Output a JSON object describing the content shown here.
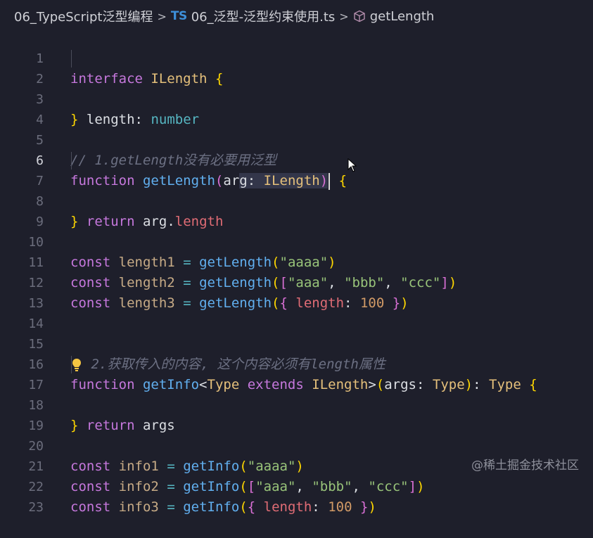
{
  "breadcrumb": {
    "folder": "06_TypeScript泛型编程",
    "ts_badge": "TS",
    "file": "06_泛型-泛型约束使用.ts",
    "symbol": "getLength",
    "icons": {
      "chevron": "chevron-right-icon",
      "symbol": "cube-icon"
    }
  },
  "lines": {
    "l1": "1",
    "l2": "2",
    "l3": "3",
    "l4": "4",
    "l5": "5",
    "l6": "6",
    "l7": "7",
    "l8": "8",
    "l9": "9",
    "l10": "10",
    "l11": "11",
    "l12": "12",
    "l13": "13",
    "l14": "14",
    "l15": "15",
    "l16": "16",
    "l17": "17",
    "l18": "18",
    "l19": "19",
    "l20": "20",
    "l21": "21",
    "l22": "22",
    "l23": "23"
  },
  "code": {
    "interface": "interface",
    "ILength": "ILength",
    "length": "length",
    "number": "number",
    "comment1": "// 1.getLength没有必要用泛型",
    "function": "function",
    "getLength": "getLength",
    "arg": "arg",
    "return": "return",
    "const": "const",
    "length1": "length1",
    "length2": "length2",
    "length3": "length3",
    "s_aaaa": "\"aaaa\"",
    "s_aaa": "\"aaa\"",
    "s_bbb": "\"bbb\"",
    "s_ccc": "\"ccc\"",
    "n100": "100",
    "comment2": "2.获取传入的内容, 这个内容必须有length属性",
    "getInfo": "getInfo",
    "Type": "Type",
    "extends": "extends",
    "args": "args",
    "info1": "info1",
    "info2": "info2",
    "info3": "info3"
  },
  "watermark": "@稀土掘金技术社区",
  "colors": {
    "background": "#1e1f2b",
    "keyword": "#c678dd",
    "function": "#61afef",
    "type": "#e5c07b",
    "string": "#98c379",
    "number": "#d19a66",
    "property": "#e06c75",
    "comment": "#6c7083"
  }
}
